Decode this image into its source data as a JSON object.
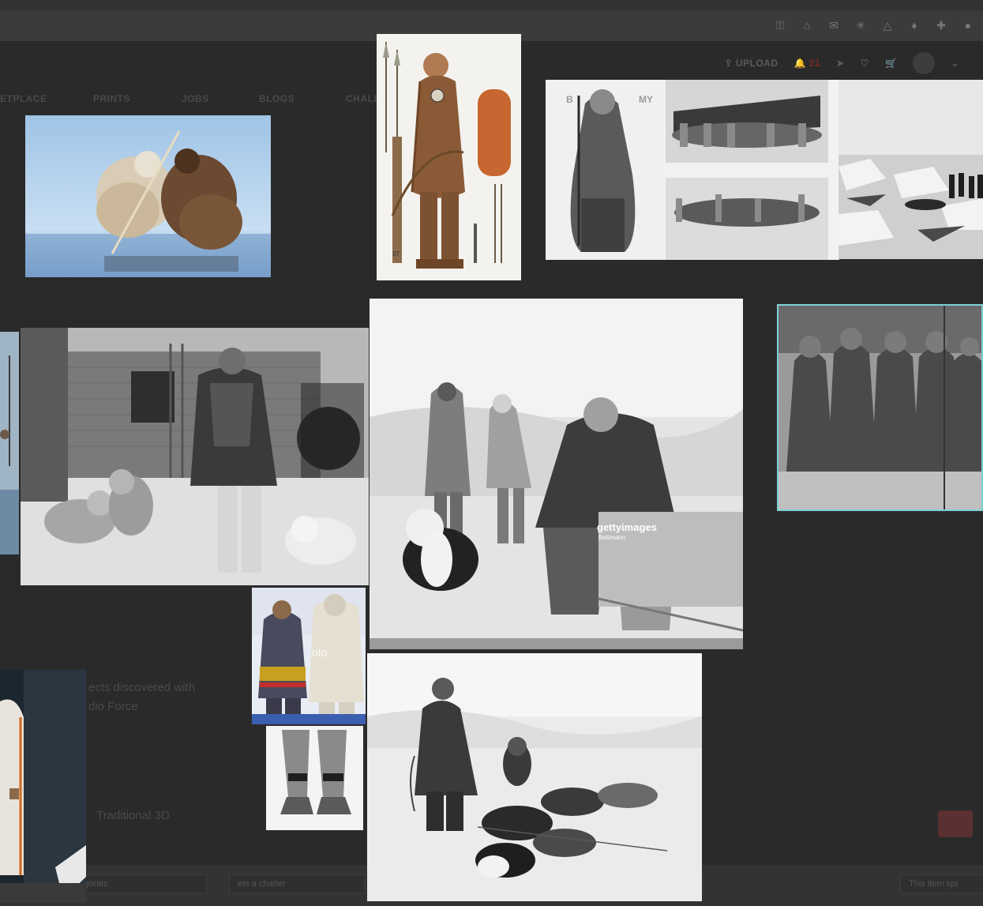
{
  "header": {
    "upload_label": "UPLOAD",
    "notification_count": "21"
  },
  "nav": {
    "items": [
      "ETPLACE",
      "PRINTS",
      "JOBS",
      "BLOGS",
      "CHALL"
    ]
  },
  "background_text": {
    "discover_line1": "ects discovered with",
    "discover_line2": "dio Force",
    "traditional": "Traditional 3D"
  },
  "images": {
    "inuit_hunters": {
      "alt": "Two hunters in fur clothing kneeling on ice"
    },
    "illustration_warrior": {
      "alt": "Illustrated figure in fur parka with weapons",
      "caption_num": "37"
    },
    "collage": {
      "alt": "Collage of historical photographs of arctic people and boats",
      "overlay_labels": [
        "B",
        "MY"
      ]
    },
    "ice_floe": {
      "alt": "Men pulling a seal across an ice floe"
    },
    "explorer_dogs": {
      "alt": "Explorer in fur parka with sled dogs beside a ship"
    },
    "getty_explorers": {
      "alt": "Explorer seated on sled with dog and two people in furs",
      "watermark": "gettyimages",
      "watermark_sub": "Bettmann"
    },
    "group_stereo": {
      "alt": "Stereograph of group in fur clothing"
    },
    "costume_display": {
      "alt": "Two people in traditional embroidered costumes",
      "watermark": "oto"
    },
    "fur_boots": {
      "alt": "Pair of fur boots"
    },
    "museum_suit": {
      "alt": "Museum display of suit in glass case"
    },
    "sled_dogs_snow": {
      "alt": "Person standing among resting sled dogs in snow"
    }
  },
  "bottom_bar": {
    "slot1": "ategories",
    "slot2": "ets a chatter",
    "slot3": "This item spr"
  },
  "colors": {
    "background": "#2a2a2a",
    "highlight_border": "#7fcfd6",
    "notif": "#7a2a2a"
  }
}
